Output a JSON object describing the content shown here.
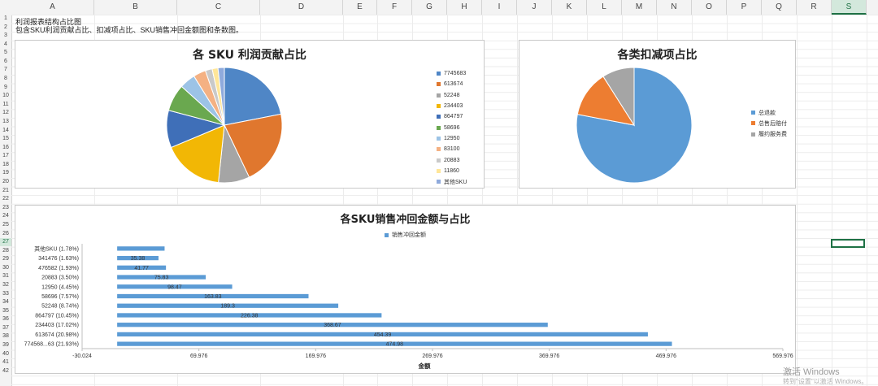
{
  "columns": [
    {
      "label": "A",
      "w": 102,
      "selected": false
    },
    {
      "label": "B",
      "w": 102,
      "selected": false
    },
    {
      "label": "C",
      "w": 102,
      "selected": false
    },
    {
      "label": "D",
      "w": 102,
      "selected": false
    },
    {
      "label": "E",
      "w": 42,
      "selected": false
    },
    {
      "label": "F",
      "w": 43,
      "selected": false
    },
    {
      "label": "G",
      "w": 43,
      "selected": false
    },
    {
      "label": "H",
      "w": 43,
      "selected": false
    },
    {
      "label": "I",
      "w": 43,
      "selected": false
    },
    {
      "label": "J",
      "w": 43,
      "selected": false
    },
    {
      "label": "K",
      "w": 43,
      "selected": false
    },
    {
      "label": "L",
      "w": 43,
      "selected": false
    },
    {
      "label": "M",
      "w": 43,
      "selected": false
    },
    {
      "label": "N",
      "w": 43,
      "selected": false
    },
    {
      "label": "O",
      "w": 43,
      "selected": false
    },
    {
      "label": "P",
      "w": 43,
      "selected": false
    },
    {
      "label": "Q",
      "w": 43,
      "selected": false
    },
    {
      "label": "R",
      "w": 43,
      "selected": false
    },
    {
      "label": "S",
      "w": 43,
      "selected": true
    }
  ],
  "rows": [
    "1",
    "2",
    "3",
    "4",
    "5",
    "6",
    "7",
    "8",
    "9",
    "10",
    "11",
    "12",
    "13",
    "14",
    "15",
    "16",
    "17",
    "18",
    "19",
    "20",
    "21",
    "22",
    "23",
    "24",
    "25",
    "26",
    "27",
    "28",
    "29",
    "30",
    "31",
    "32",
    "33",
    "34",
    "35",
    "36",
    "37",
    "38",
    "39",
    "40",
    "41",
    "42"
  ],
  "selected_row": "27",
  "cells": {
    "a1": "利润报表结构占比图",
    "a2": "包含SKU利润贡献占比、扣减项占比、SKU销售冲回金额图和条数图。"
  },
  "watermark": {
    "line1": "激活 Windows",
    "line2": "转到\"设置\"以激活 Windows。"
  },
  "chart_data": [
    {
      "type": "pie",
      "title": "各 SKU 利润贡献占比",
      "legend_position": "right",
      "series": [
        {
          "name": "7745683",
          "value": 21.93,
          "color": "#4f86c6"
        },
        {
          "name": "613674",
          "value": 20.98,
          "color": "#e0772e"
        },
        {
          "name": "52248",
          "value": 8.74,
          "color": "#a5a5a5"
        },
        {
          "name": "234403",
          "value": 17.02,
          "color": "#f2b705"
        },
        {
          "name": "864797",
          "value": 10.45,
          "color": "#3f6fb8"
        },
        {
          "name": "58696",
          "value": 7.57,
          "color": "#6aa84f"
        },
        {
          "name": "12950",
          "value": 4.45,
          "color": "#9cc3e6"
        },
        {
          "name": "83100",
          "value": 3.5,
          "color": "#f4b183"
        },
        {
          "name": "20883",
          "value": 1.93,
          "color": "#c9c9c9"
        },
        {
          "name": "11860",
          "value": 1.63,
          "color": "#ffe699"
        },
        {
          "name": "其他SKU",
          "value": 1.78,
          "color": "#8faadc"
        }
      ]
    },
    {
      "type": "pie",
      "title": "各类扣减项占比",
      "legend_position": "right",
      "series": [
        {
          "name": "总退款",
          "value": 78,
          "color": "#5b9bd5"
        },
        {
          "name": "总售后赔付",
          "value": 13,
          "color": "#ed7d31"
        },
        {
          "name": "履约服务费",
          "value": 9,
          "color": "#a5a5a5"
        }
      ]
    },
    {
      "type": "bar",
      "orientation": "horizontal",
      "title": "各SKU销售冲回金额与占比",
      "legend": "销售冲回金额",
      "xlabel": "金额",
      "xlim": [
        -30.024,
        569.976
      ],
      "xticks": [
        "-30.024",
        "69.976",
        "169.976",
        "269.976",
        "369.976",
        "469.976",
        "569.976"
      ],
      "color": "#5b9bd5",
      "categories": [
        "其他SKU (1.78%)",
        "341476 (1.63%)",
        "476582 (1.93%)",
        "20883 (3.50%)",
        "12950 (4.45%)",
        "58696 (7.57%)",
        "52248 (8.74%)",
        "864797 (10.45%)",
        "234403 (17.02%)",
        "613674 (20.98%)",
        "774568...63 (21.93%)"
      ],
      "values": [
        40.6,
        35.38,
        41.77,
        75.83,
        98.47,
        163.83,
        189.3,
        226.38,
        368.67,
        454.39,
        474.98
      ],
      "labels": [
        "",
        "35.38",
        "41.77",
        "75.83",
        "98.47",
        "163.83",
        "189.3",
        "226.38",
        "368.67",
        "454.39",
        "474.98"
      ]
    }
  ]
}
